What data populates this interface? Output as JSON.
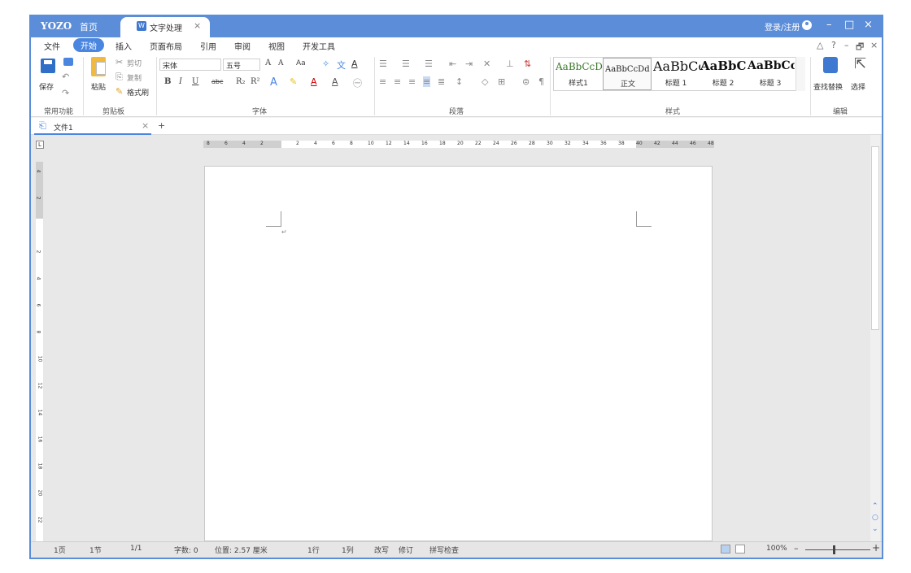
{
  "titlebar": {
    "logo": "YOZO",
    "home_tab": "首页",
    "doc_tab": "文字处理",
    "doc_icon": "W",
    "close": "×",
    "login": "登录/注册",
    "minimize": "–",
    "maximize": "□",
    "win_close": "×"
  },
  "menu": {
    "items": [
      "文件",
      "开始",
      "插入",
      "页面布局",
      "引用",
      "审阅",
      "视图",
      "开发工具"
    ],
    "active": "开始",
    "right_controls": [
      "△",
      "?",
      "–",
      "🗗",
      "×"
    ]
  },
  "ribbon": {
    "common": {
      "save": "保存",
      "group": "常用功能"
    },
    "clipboard": {
      "paste": "粘贴",
      "cut": "剪切",
      "copy": "复制",
      "format_painter": "格式刷",
      "group": "剪贴板"
    },
    "font": {
      "font_name": "宋体",
      "font_size": "五号",
      "grow": "A",
      "shrink": "A",
      "case": "Aa",
      "bold": "B",
      "italic": "I",
      "underline": "U",
      "strike": "abc",
      "sub": "R₂",
      "sup": "R²",
      "group": "字体"
    },
    "paragraph": {
      "group": "段落"
    },
    "styles": {
      "items": [
        {
          "sample": "AaBbCcDd",
          "name": "样式1",
          "color": "#3a7a2a",
          "size": "12px"
        },
        {
          "sample": "AaBbCcDd",
          "name": "正文",
          "color": "#222222",
          "size": "10px"
        },
        {
          "sample": "AaBbCc",
          "name": "标题 1",
          "color": "#111111",
          "size": "16px"
        },
        {
          "sample": "AaBbC",
          "name": "标题 2",
          "color": "#111111",
          "size": "15px"
        },
        {
          "sample": "AaBbCcI",
          "name": "标题 3",
          "color": "#111111",
          "size": "14px"
        }
      ],
      "group": "样式"
    },
    "editing": {
      "find_replace": "查找替换",
      "select": "选择",
      "group": "编辑"
    }
  },
  "tabs": {
    "file_tab": "文件1",
    "close": "×",
    "add": "+"
  },
  "hruler_ticks": [
    "8",
    "6",
    "4",
    "2",
    "",
    "2",
    "4",
    "6",
    "8",
    "10",
    "12",
    "14",
    "16",
    "18",
    "20",
    "22",
    "24",
    "26",
    "28",
    "30",
    "32",
    "34",
    "36",
    "38",
    "40",
    "42",
    "44",
    "46",
    "48"
  ],
  "vruler_ticks": [
    "4",
    "2",
    "",
    "2",
    "4",
    "6",
    "8",
    "10",
    "12",
    "14",
    "16",
    "18",
    "20",
    "22"
  ],
  "status": {
    "page": "1页",
    "section": "1节",
    "pages": "1/1",
    "words": "字数: 0",
    "position": "位置: 2.57 厘米",
    "line": "1行",
    "column": "1列",
    "overtype": "改写",
    "track": "修订",
    "spell": "拼写检查",
    "zoom": "100%",
    "zoom_minus": "–",
    "zoom_plus": "+"
  }
}
